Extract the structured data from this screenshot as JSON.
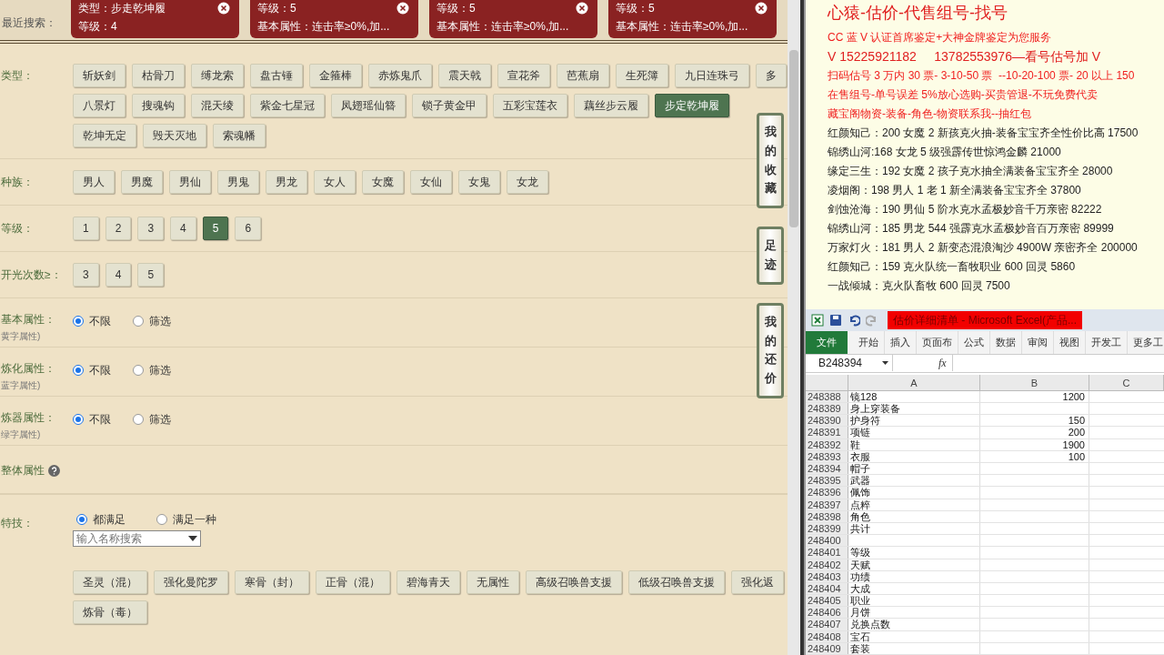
{
  "recent_search": {
    "label": "最近搜索：",
    "cards": [
      {
        "lines": [
          "类型：步走乾坤履",
          "等级：4"
        ]
      },
      {
        "lines": [
          "等级：5",
          "基本属性：连击率≥0%,加..."
        ]
      },
      {
        "lines": [
          "等级：5",
          "基本属性：连击率≥0%,加..."
        ]
      },
      {
        "lines": [
          "等级：5",
          "基本属性：连击率≥0%,加..."
        ]
      }
    ]
  },
  "filters": [
    {
      "kind": "buttons",
      "label": "类型：",
      "option_rows": [
        [
          {
            "text": "斩妖剑",
            "selected": false
          },
          {
            "text": "枯骨刀",
            "selected": false
          },
          {
            "text": "缚龙索",
            "selected": false
          },
          {
            "text": "盘古锤",
            "selected": false
          },
          {
            "text": "金箍棒",
            "selected": false
          },
          {
            "text": "赤炼鬼爪",
            "selected": false
          },
          {
            "text": "震天戟",
            "selected": false
          },
          {
            "text": "宣花斧",
            "selected": false
          },
          {
            "text": "芭蕉扇",
            "selected": false
          },
          {
            "text": "生死簿",
            "selected": false
          },
          {
            "text": "九日连珠弓",
            "selected": false
          },
          {
            "text": "多",
            "selected": false
          }
        ],
        [
          {
            "text": "八景灯",
            "selected": false
          },
          {
            "text": "搜魂钩",
            "selected": false
          },
          {
            "text": "混天绫",
            "selected": false
          },
          {
            "text": "紫金七星冠",
            "selected": false
          },
          {
            "text": "凤翅瑶仙簪",
            "selected": false
          },
          {
            "text": "锁子黄金甲",
            "selected": false
          },
          {
            "text": "五彩宝莲衣",
            "selected": false
          },
          {
            "text": "藕丝步云履",
            "selected": false
          },
          {
            "text": "步定乾坤履",
            "selected": true
          }
        ],
        [
          {
            "text": "乾坤无定",
            "selected": false
          },
          {
            "text": "毁天灭地",
            "selected": false
          },
          {
            "text": "索魂幡",
            "selected": false
          }
        ]
      ]
    },
    {
      "kind": "buttons",
      "label": "种族：",
      "option_rows": [
        [
          {
            "text": "男人",
            "selected": false
          },
          {
            "text": "男魔",
            "selected": false
          },
          {
            "text": "男仙",
            "selected": false
          },
          {
            "text": "男鬼",
            "selected": false
          },
          {
            "text": "男龙",
            "selected": false
          },
          {
            "text": "女人",
            "selected": false
          },
          {
            "text": "女魔",
            "selected": false
          },
          {
            "text": "女仙",
            "selected": false
          },
          {
            "text": "女鬼",
            "selected": false
          },
          {
            "text": "女龙",
            "selected": false
          }
        ]
      ]
    },
    {
      "kind": "buttons",
      "label": "等级：",
      "option_rows": [
        [
          {
            "text": "1",
            "selected": false
          },
          {
            "text": "2",
            "selected": false
          },
          {
            "text": "3",
            "selected": false
          },
          {
            "text": "4",
            "selected": false
          },
          {
            "text": "5",
            "selected": true
          },
          {
            "text": "6",
            "selected": false
          }
        ]
      ]
    },
    {
      "kind": "buttons",
      "label": "开光次数≥：",
      "option_rows": [
        [
          {
            "text": "3",
            "selected": false
          },
          {
            "text": "4",
            "selected": false
          },
          {
            "text": "5",
            "selected": false
          }
        ]
      ]
    },
    {
      "kind": "radio",
      "label": "基本属性：",
      "sublabel": "黄字属性)",
      "options": [
        {
          "text": "不限",
          "selected": true
        },
        {
          "text": "筛选",
          "selected": false
        }
      ]
    },
    {
      "kind": "radio",
      "label": "炼化属性：",
      "sublabel": "蓝字属性)",
      "options": [
        {
          "text": "不限",
          "selected": true
        },
        {
          "text": "筛选",
          "selected": false
        }
      ]
    },
    {
      "kind": "radio",
      "label": "炼器属性：",
      "sublabel": "绿字属性)",
      "options": [
        {
          "text": "不限",
          "selected": true
        },
        {
          "text": "筛选",
          "selected": false
        }
      ]
    },
    {
      "kind": "help",
      "label": "整体属性"
    },
    {
      "kind": "skills",
      "label": "特技：",
      "options": [
        {
          "text": "都满足",
          "selected": true
        },
        {
          "text": "满足一种",
          "selected": false
        }
      ],
      "search": {
        "placeholder": "输入名称搜索"
      },
      "option_rows": [
        [
          {
            "text": "圣灵（混）",
            "selected": false
          },
          {
            "text": "强化曼陀罗",
            "selected": false
          },
          {
            "text": "寒骨（封）",
            "selected": false
          },
          {
            "text": "正骨（混）",
            "selected": false
          },
          {
            "text": "碧海青天",
            "selected": false
          },
          {
            "text": "无属性",
            "selected": false
          },
          {
            "text": "高级召唤兽支援",
            "selected": false
          },
          {
            "text": "低级召唤兽支援",
            "selected": false
          },
          {
            "text": "强化返",
            "selected": false
          }
        ],
        [
          {
            "text": "炼骨（毒）",
            "selected": false
          }
        ]
      ]
    }
  ],
  "side_tabs": [
    "我的收藏",
    "足迹",
    "我的还价"
  ],
  "notes": [
    {
      "kind": "title",
      "text": "心猿-估价-代售组号-找号"
    },
    {
      "kind": "ad",
      "text": "CC 蓝 V 认证首席鉴定+大神金牌鉴定为您服务"
    },
    {
      "kind": "phone",
      "text": "V 15225921182     13782553976—看号估号加 V"
    },
    {
      "kind": "ad",
      "text": "扫码估号 3 万内 30 票- 3-10-50 票  --10-20-100 票- 20 以上 150"
    },
    {
      "kind": "ad",
      "text": "在售组号-单号误差 5%放心选购-买贵管退-不玩免费代卖"
    },
    {
      "kind": "ad",
      "text": "藏宝阁物资-装备-角色-物资联系我--抽红包"
    },
    {
      "kind": "listing",
      "text": "红颜知己：200 女魔 2 新孩克火抽-装备宝宝齐全性价比高 17500"
    },
    {
      "kind": "listing",
      "text": "锦绣山河:168 女龙 5 级强霹传世惊鸿金麟 21000"
    },
    {
      "kind": "listing",
      "text": "缘定三生：192 女魔 2 孩子克水抽全满装备宝宝齐全 28000"
    },
    {
      "kind": "listing",
      "text": "凌烟阁：198 男人 1 老 1 新全满装备宝宝齐全 37800"
    },
    {
      "kind": "listing",
      "text": "剑蚀沧海：190 男仙 5 阶水克水孟极妙音千万亲密 82222"
    },
    {
      "kind": "listing",
      "text": "锦绣山河：185 男龙 544 强霹克水孟极妙音百万亲密 89999"
    },
    {
      "kind": "listing",
      "text": "万家灯火：181 男人 2 新变态混浪淘沙 4900W 亲密齐全 200000"
    },
    {
      "kind": "listing",
      "text": "红颜知己：159 克火队统一畜牧职业 600 回灵 5860"
    },
    {
      "kind": "listing",
      "text": "一战倾城：克火队畜牧 600 回灵 7500"
    }
  ],
  "excel": {
    "title": "估价详细清单 - Microsoft Excel(产品...",
    "ribbon_tabs": [
      {
        "text": "文件",
        "selected": true
      },
      {
        "text": "开始",
        "selected": false
      },
      {
        "text": "插入",
        "selected": false
      },
      {
        "text": "页面布",
        "selected": false
      },
      {
        "text": "公式",
        "selected": false
      },
      {
        "text": "数据",
        "selected": false
      },
      {
        "text": "审阅",
        "selected": false
      },
      {
        "text": "视图",
        "selected": false
      },
      {
        "text": "开发工",
        "selected": false
      },
      {
        "text": "更多工",
        "selected": false
      }
    ],
    "name_box": "B248394",
    "formula_label": "fx",
    "columns": [
      "A",
      "B",
      "C"
    ],
    "rows": [
      {
        "num": "248388",
        "a": "镜128",
        "b": "1200"
      },
      {
        "num": "248389",
        "a": "身上穿装备"
      },
      {
        "num": "248390",
        "a": "护身符",
        "b": "150"
      },
      {
        "num": "248391",
        "a": "项链",
        "b": "200"
      },
      {
        "num": "248392",
        "a": "鞋",
        "b": "1900"
      },
      {
        "num": "248393",
        "a": "衣服",
        "b": "100"
      },
      {
        "num": "248394",
        "a": "帽子"
      },
      {
        "num": "248395",
        "a": "武器"
      },
      {
        "num": "248396",
        "a": "佩饰"
      },
      {
        "num": "248397",
        "a": "点粹"
      },
      {
        "num": "248398",
        "a": "角色"
      },
      {
        "num": "248399",
        "a": "共计"
      },
      {
        "num": "248400"
      },
      {
        "num": "248401",
        "a": "等级"
      },
      {
        "num": "248402",
        "a": "天赋"
      },
      {
        "num": "248403",
        "a": "功绩"
      },
      {
        "num": "248404",
        "a": "大成"
      },
      {
        "num": "248405",
        "a": "职业"
      },
      {
        "num": "248406",
        "a": "月饼"
      },
      {
        "num": "248407",
        "a": "兑换点数"
      },
      {
        "num": "248408",
        "a": "宝石"
      },
      {
        "num": "248409",
        "a": "套装"
      }
    ]
  }
}
